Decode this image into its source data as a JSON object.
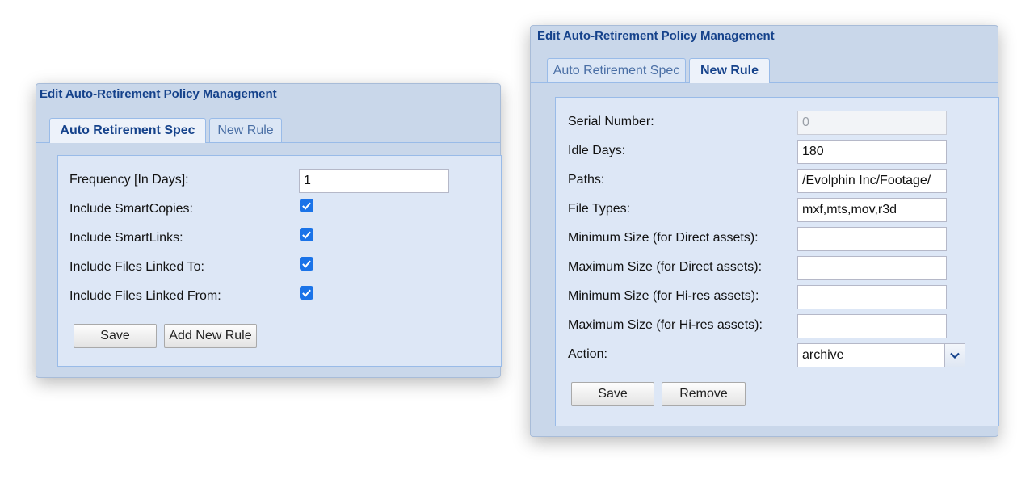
{
  "left_panel": {
    "title": "Edit Auto-Retirement Policy Management",
    "tabs": [
      {
        "label": "Auto Retirement Spec",
        "active": true
      },
      {
        "label": "New Rule",
        "active": false
      }
    ],
    "fields": {
      "frequency_label": "Frequency [In Days]:",
      "frequency_value": "1",
      "smartcopies_label": "Include SmartCopies:",
      "smartlinks_label": "Include SmartLinks:",
      "linked_to_label": "Include Files Linked To:",
      "linked_from_label": "Include Files Linked From:"
    },
    "buttons": {
      "save": "Save",
      "add_rule": "Add New Rule"
    }
  },
  "right_panel": {
    "title": "Edit Auto-Retirement Policy Management",
    "tabs": [
      {
        "label": "Auto Retirement Spec",
        "active": false
      },
      {
        "label": "New Rule",
        "active": true
      }
    ],
    "fields": {
      "serial_label": "Serial Number:",
      "serial_value": "0",
      "idle_label": "Idle Days:",
      "idle_value": "180",
      "paths_label": "Paths:",
      "paths_value": "/Evolphin Inc/Footage/",
      "types_label": "File Types:",
      "types_value": "mxf,mts,mov,r3d",
      "min_direct_label": "Minimum Size (for Direct assets):",
      "min_direct_value": "",
      "max_direct_label": "Maximum Size (for Direct assets):",
      "max_direct_value": "",
      "min_hires_label": "Minimum Size (for Hi-res assets):",
      "min_hires_value": "",
      "max_hires_label": "Maximum Size (for Hi-res assets):",
      "max_hires_value": "",
      "action_label": "Action:",
      "action_value": "archive"
    },
    "buttons": {
      "save": "Save",
      "remove": "Remove"
    }
  },
  "colors": {
    "accent": "#15428b",
    "checkbox": "#1a73e8",
    "panel_bg": "#c9d7ea"
  }
}
